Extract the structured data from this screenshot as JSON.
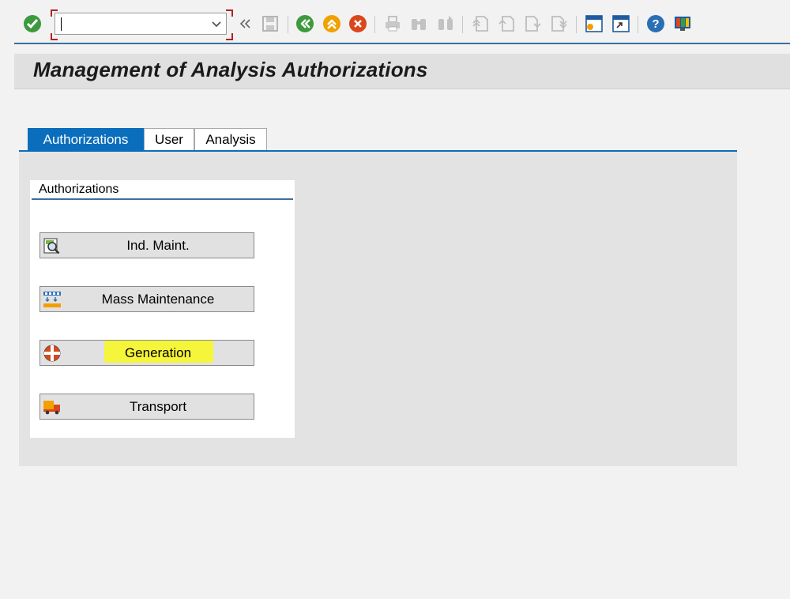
{
  "toolbar": {
    "command_value": "",
    "icons": [
      "enter-icon",
      "back-icon",
      "exit-icon",
      "cancel-icon",
      "print-icon",
      "find-icon",
      "find-next-icon",
      "first-page-icon",
      "previous-page-icon",
      "next-page-icon",
      "last-page-icon",
      "new-session-icon",
      "create-shortcut-icon",
      "help-icon",
      "customize-layout-icon"
    ]
  },
  "page": {
    "title": "Management of Analysis Authorizations"
  },
  "tabs": [
    {
      "label": "Authorizations",
      "active": true
    },
    {
      "label": "User",
      "active": false
    },
    {
      "label": "Analysis",
      "active": false
    }
  ],
  "group": {
    "title": "Authorizations",
    "buttons": [
      {
        "label": "Ind. Maint.",
        "icon": "magnifier-document-icon"
      },
      {
        "label": "Mass Maintenance",
        "icon": "mass-maintenance-icon"
      },
      {
        "label": "Generation",
        "icon": "generation-icon",
        "highlighted": true
      },
      {
        "label": "Transport",
        "icon": "transport-truck-icon"
      }
    ]
  },
  "colors": {
    "accent": "#0a6ebd",
    "highlight": "#f5f532",
    "background": "#f2f2f2"
  }
}
